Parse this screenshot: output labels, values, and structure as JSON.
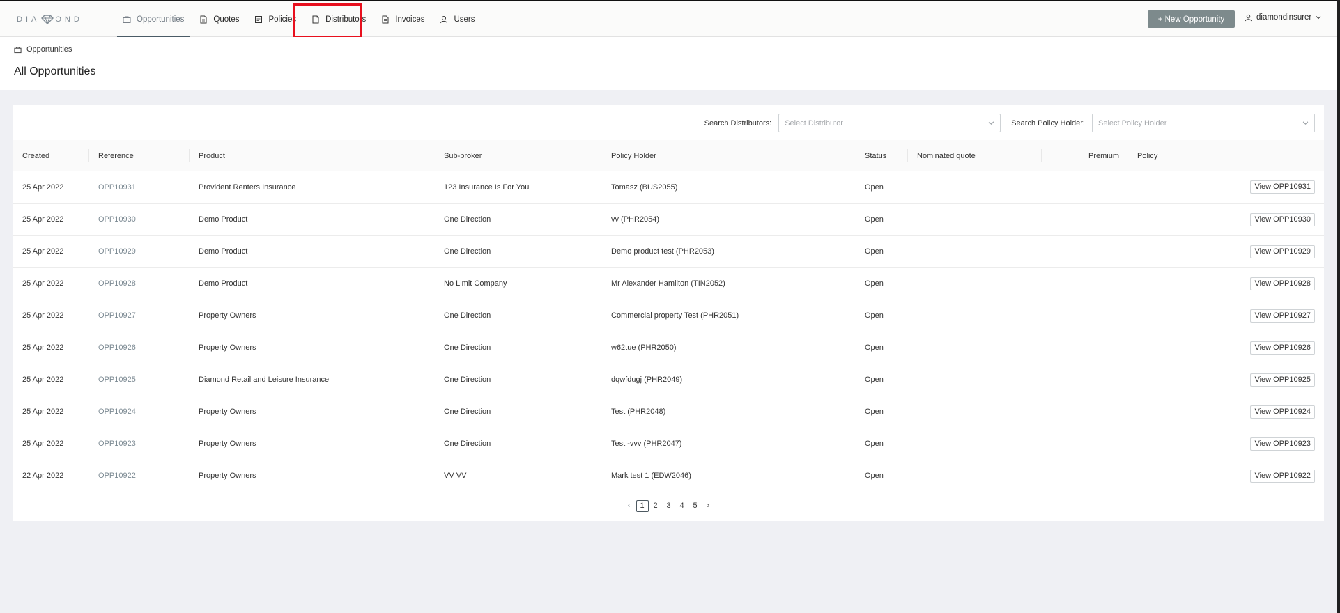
{
  "brand": {
    "logo_text_left": "DIA",
    "logo_text_right": "OND"
  },
  "nav": {
    "items": [
      {
        "label": "Opportunities",
        "icon": "briefcase-icon",
        "active": true
      },
      {
        "label": "Quotes",
        "icon": "document-icon",
        "active": false
      },
      {
        "label": "Policies",
        "icon": "policy-icon",
        "active": false
      },
      {
        "label": "Distributors",
        "icon": "file-icon",
        "active": false
      },
      {
        "label": "Invoices",
        "icon": "invoice-icon",
        "active": false
      },
      {
        "label": "Users",
        "icon": "user-icon",
        "active": false
      }
    ],
    "new_button": "+ New Opportunity",
    "user": "diamondinsurer"
  },
  "header": {
    "breadcrumb": "Opportunities",
    "title": "All Opportunities"
  },
  "filters": {
    "distributors_label": "Search Distributors:",
    "distributors_placeholder": "Select Distributor",
    "policy_holder_label": "Search Policy Holder:",
    "policy_holder_placeholder": "Select Policy Holder"
  },
  "table": {
    "columns": [
      "Created",
      "Reference",
      "Product",
      "Sub-broker",
      "Policy Holder",
      "Status",
      "Nominated quote",
      "Premium",
      "Policy"
    ],
    "rows": [
      {
        "created": "25 Apr 2022",
        "reference": "OPP10931",
        "product": "Provident Renters Insurance",
        "subbroker": "123 Insurance Is For You",
        "holder": "Tomasz (BUS2055)",
        "status": "Open",
        "action": "View OPP10931"
      },
      {
        "created": "25 Apr 2022",
        "reference": "OPP10930",
        "product": "Demo Product",
        "subbroker": "One Direction",
        "holder": "vv (PHR2054)",
        "status": "Open",
        "action": "View OPP10930"
      },
      {
        "created": "25 Apr 2022",
        "reference": "OPP10929",
        "product": "Demo Product",
        "subbroker": "One Direction",
        "holder": "Demo product test (PHR2053)",
        "status": "Open",
        "action": "View OPP10929"
      },
      {
        "created": "25 Apr 2022",
        "reference": "OPP10928",
        "product": "Demo Product",
        "subbroker": "No Limit Company",
        "holder": "Mr Alexander Hamilton (TIN2052)",
        "status": "Open",
        "action": "View OPP10928"
      },
      {
        "created": "25 Apr 2022",
        "reference": "OPP10927",
        "product": "Property Owners",
        "subbroker": "One Direction",
        "holder": "Commercial property Test (PHR2051)",
        "status": "Open",
        "action": "View OPP10927"
      },
      {
        "created": "25 Apr 2022",
        "reference": "OPP10926",
        "product": "Property Owners",
        "subbroker": "One Direction",
        "holder": "w62tue (PHR2050)",
        "status": "Open",
        "action": "View OPP10926"
      },
      {
        "created": "25 Apr 2022",
        "reference": "OPP10925",
        "product": "Diamond Retail and Leisure Insurance",
        "subbroker": "One Direction",
        "holder": "dqwfdugj (PHR2049)",
        "status": "Open",
        "action": "View OPP10925"
      },
      {
        "created": "25 Apr 2022",
        "reference": "OPP10924",
        "product": "Property Owners",
        "subbroker": "One Direction",
        "holder": "Test (PHR2048)",
        "status": "Open",
        "action": "View OPP10924"
      },
      {
        "created": "25 Apr 2022",
        "reference": "OPP10923",
        "product": "Property Owners",
        "subbroker": "One Direction",
        "holder": "Test -vvv (PHR2047)",
        "status": "Open",
        "action": "View OPP10923"
      },
      {
        "created": "22 Apr 2022",
        "reference": "OPP10922",
        "product": "Property Owners",
        "subbroker": "VV VV",
        "holder": "Mark test 1 (EDW2046)",
        "status": "Open",
        "action": "View OPP10922"
      }
    ]
  },
  "pagination": {
    "prev": "‹",
    "pages": [
      "1",
      "2",
      "3",
      "4",
      "5"
    ],
    "current": "1",
    "next": "›"
  },
  "colors": {
    "accent": "#7d8a8c",
    "highlight": "#e8101e",
    "link": "#7c8a93"
  }
}
